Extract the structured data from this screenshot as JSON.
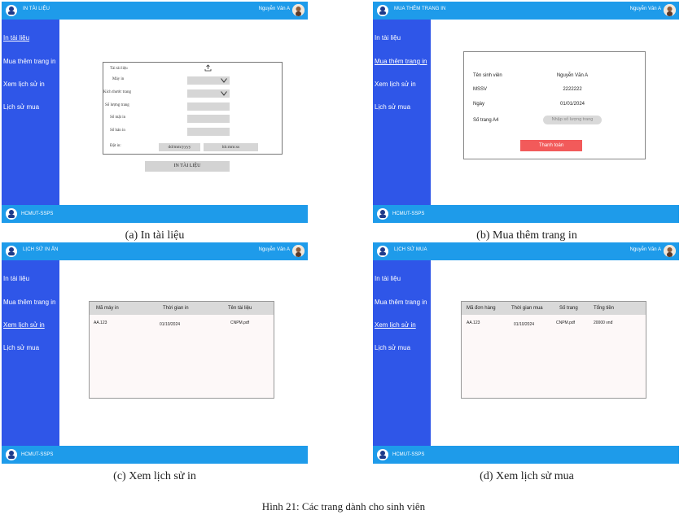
{
  "common": {
    "user_name": "Nguyễn Văn A",
    "footer_label": "HCMUT-SSPS",
    "nav": [
      "In tài liệu",
      "Mua thêm trang in",
      "Xem lịch sử in",
      "Lịch sử mua"
    ]
  },
  "panels": {
    "a": {
      "header_title": "IN TÀI LIỆU",
      "caption": "(a) In tài liệu",
      "form": {
        "document_label": "Tài tài liệu",
        "printer_label": "Máy in",
        "paper_size_label": "Kích thước trang",
        "page_count_label": "Số lượng trang",
        "sides_label": "Số mặt in",
        "copies_label": "Số bản in",
        "time_label": "Đặt in:",
        "date_placeholder": "dd/mm/yyyy",
        "time_placeholder": "hh:mm:ss"
      },
      "submit_label": "IN TÀI LIỆU"
    },
    "b": {
      "header_title": "MUA THÊM TRANG IN",
      "caption": "(b) Mua thêm trang in",
      "student_name_label": "Tên sinh viên",
      "student_name_value": "Nguyễn Văn A",
      "mssv_label": "MSSV",
      "mssv_value": "2222222",
      "date_label": "Ngày",
      "date_value": "01/01/2024",
      "pages_label": "Số trang A4",
      "pages_placeholder": "Nhập số lượng trang",
      "pay_label": "Thanh toán"
    },
    "c": {
      "header_title": "LỊCH SỬ IN ẤN",
      "caption": "(c) Xem lịch sử in",
      "columns": [
        "Mã máy in",
        "Thời gian in",
        "Tên tài liệu"
      ],
      "rows": [
        [
          "AA.123",
          "01/10/2024",
          "CNPM.pdf"
        ]
      ]
    },
    "d": {
      "header_title": "LỊCH SỬ MUA",
      "caption": "(d) Xem lịch sử mua",
      "columns": [
        "Mã đơn hàng",
        "Thời gian mua",
        "Số trang",
        "Tổng tiền"
      ],
      "rows": [
        [
          "AA.123",
          "01/10/2024",
          "CNPM.pdf",
          "20000 vnđ"
        ]
      ]
    }
  },
  "figure_caption": "Hình 21: Các trang dành cho sinh viên",
  "colors": {
    "header": "#1e9bea",
    "sidebar": "#2f56e8",
    "pay_button": "#f25a5a",
    "field": "#d6d6d6"
  }
}
